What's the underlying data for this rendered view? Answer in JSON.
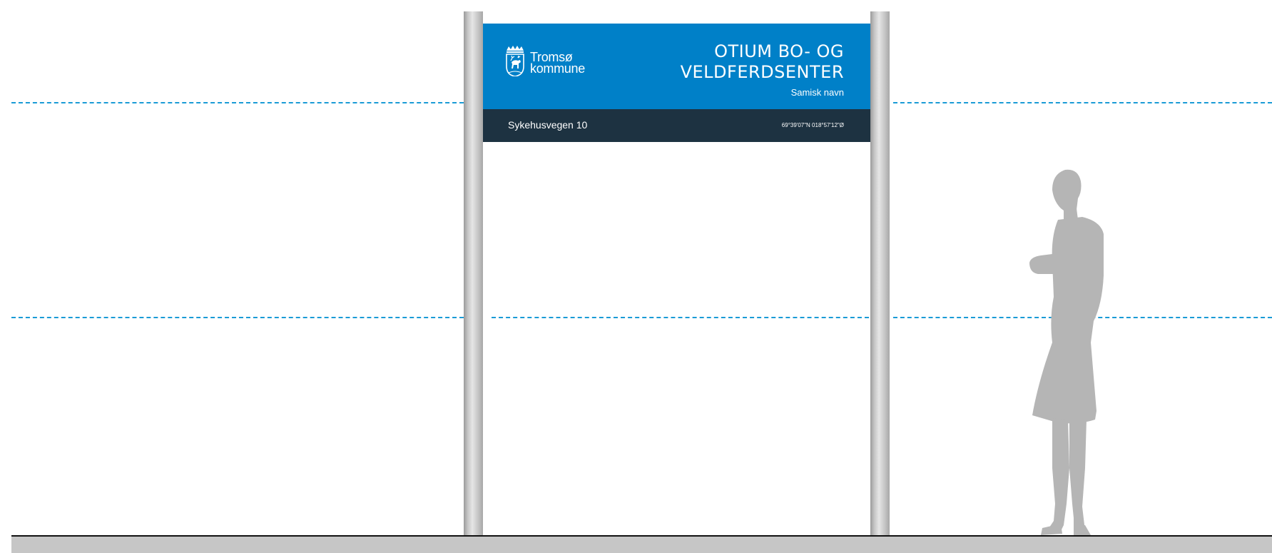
{
  "sign": {
    "logo_line1": "Tromsø",
    "logo_line2": "kommune",
    "title_line1": "OTIUM BO- OG",
    "title_line2": "VELDFERDSENTER",
    "subtitle": "Samisk navn",
    "address": "Sykehusvegen 10",
    "coordinates": "69°39'07\"N 018°57'12\"Ø"
  },
  "colors": {
    "sign_primary": "#0080c8",
    "sign_secondary": "#1d3241",
    "guide_line": "#1a9bd6",
    "post": "#c4c4c4",
    "silhouette": "#b5b5b5",
    "ground": "#c6c6c6"
  },
  "icons": {
    "crest": "tromso-reindeer-crest-icon",
    "figure": "person-silhouette"
  }
}
